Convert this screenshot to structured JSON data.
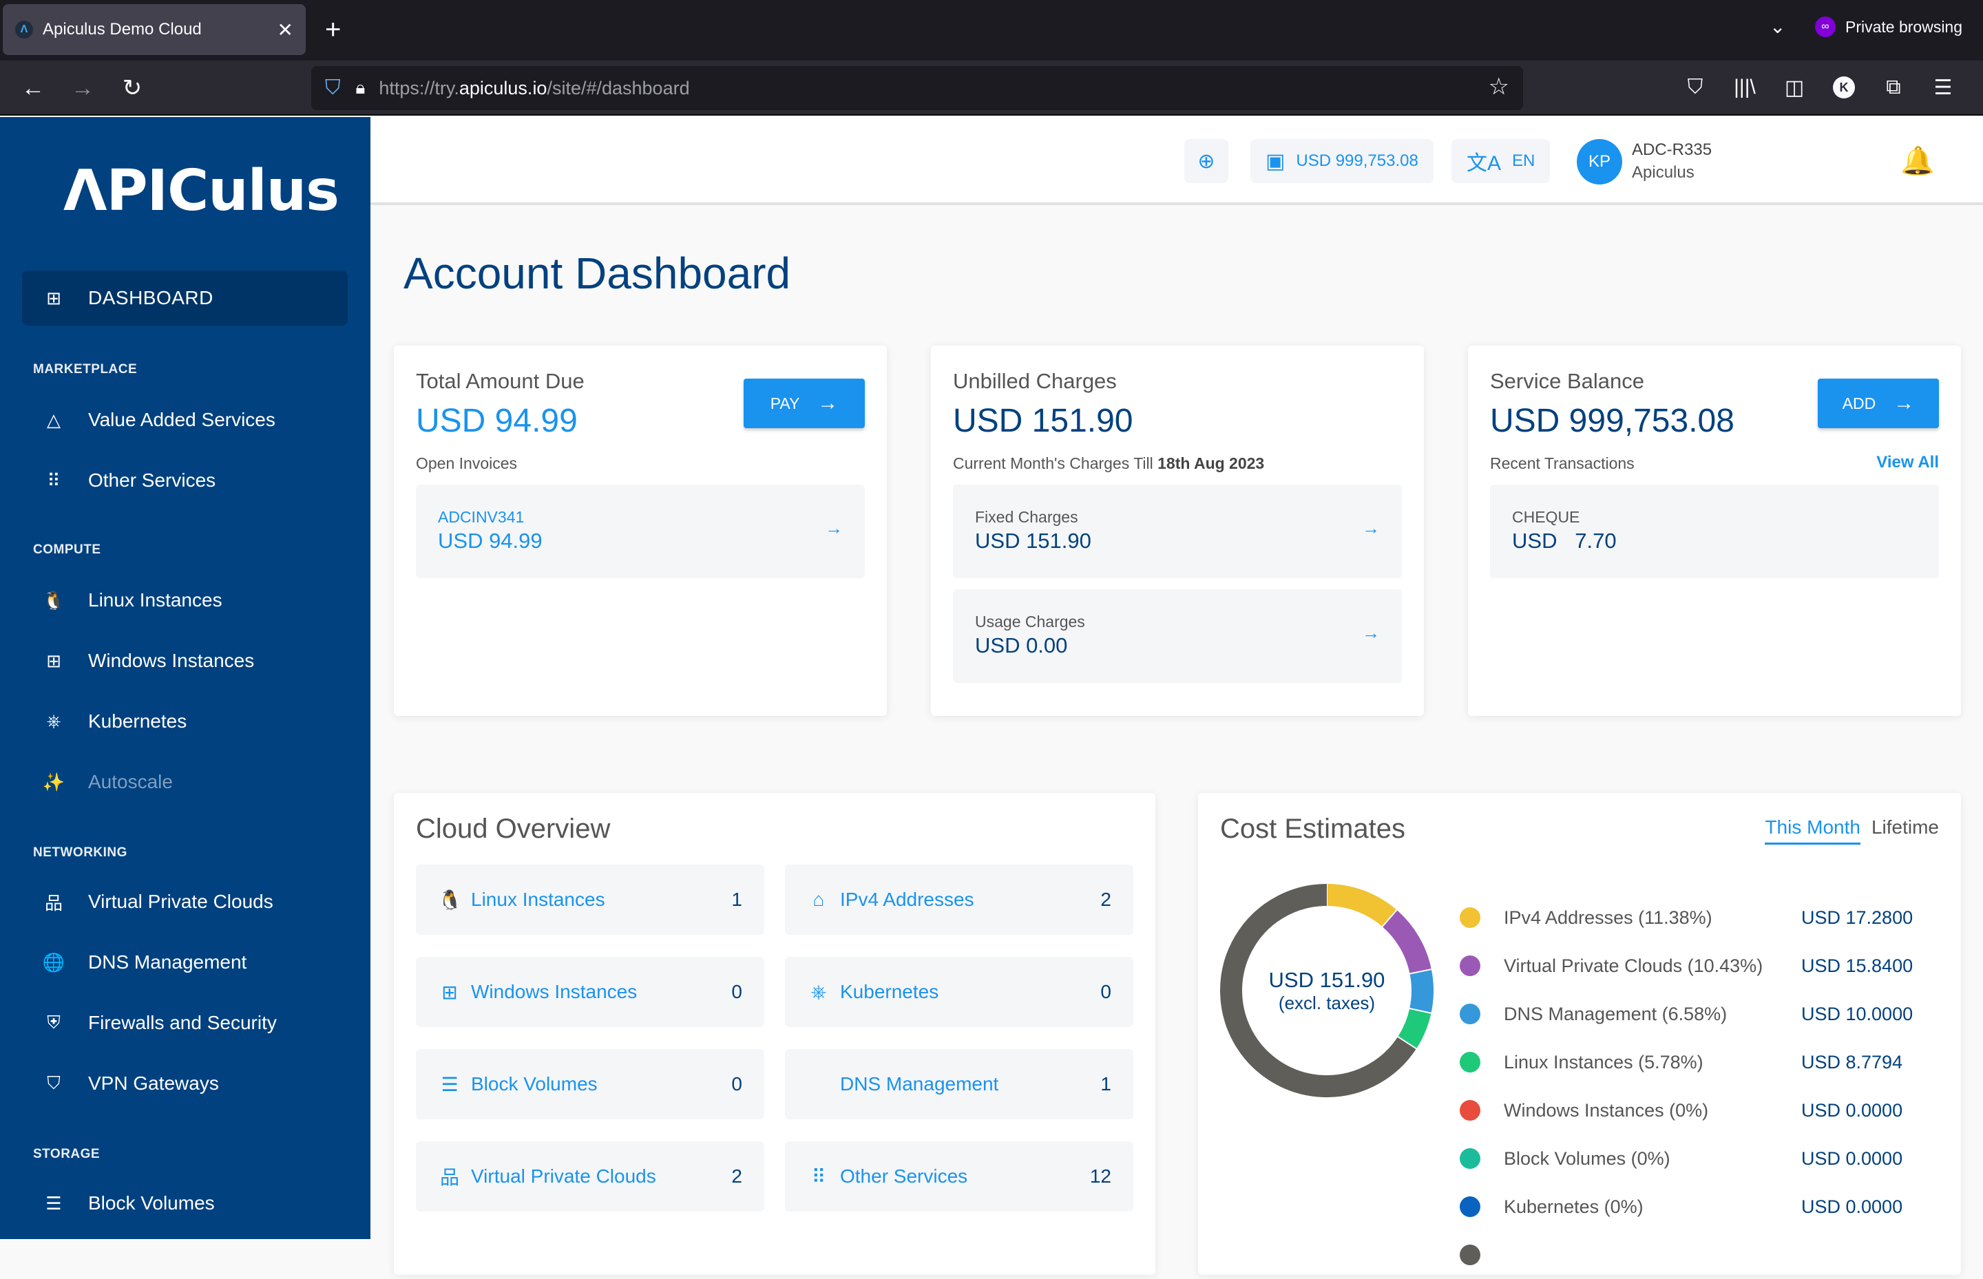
{
  "browser": {
    "tab_title": "Apiculus Demo Cloud",
    "tab_favicon": "Λ",
    "close_icon": "✕",
    "new_tab_icon": "+",
    "tabs_menu_icon": "⌄",
    "private_label": "Private browsing",
    "url_prefix": "https://try.",
    "url_domain": "apiculus.io",
    "url_path": "/site/#/dashboard",
    "back_icon": "←",
    "forward_icon": "→",
    "reload_icon": "↻",
    "shield_icon": "⛉",
    "lock_icon": "🔒",
    "star_icon": "☆",
    "toolbar_icons": {
      "pocket": "⛉",
      "library": "|||\\",
      "sidebar": "◫",
      "account": "K",
      "extensions": "⧉",
      "menu": "☰"
    }
  },
  "sidebar": {
    "logo": "ΛPICulus",
    "dashboard": {
      "label": "DASHBOARD",
      "icon": "⊞"
    },
    "sections": [
      {
        "title": "MARKETPLACE",
        "items": [
          {
            "label": "Value Added Services",
            "icon": "△"
          },
          {
            "label": "Other Services",
            "icon": "⠿"
          }
        ]
      },
      {
        "title": "COMPUTE",
        "items": [
          {
            "label": "Linux Instances",
            "icon": "🐧"
          },
          {
            "label": "Windows Instances",
            "icon": "⊞"
          },
          {
            "label": "Kubernetes",
            "icon": "⎈"
          },
          {
            "label": "Autoscale",
            "icon": "✨",
            "disabled": true
          }
        ]
      },
      {
        "title": "NETWORKING",
        "items": [
          {
            "label": "Virtual Private Clouds",
            "icon": "品"
          },
          {
            "label": "DNS Management",
            "icon": "🌐"
          },
          {
            "label": "Firewalls and Security",
            "icon": "⛨"
          },
          {
            "label": "VPN Gateways",
            "icon": "⛉"
          }
        ]
      },
      {
        "title": "STORAGE",
        "items": [
          {
            "label": "Block Volumes",
            "icon": "☰"
          }
        ]
      }
    ]
  },
  "header": {
    "support_icon": "⊕",
    "wallet_icon": "▣",
    "balance": "USD 999,753.08",
    "language_icon": "文A",
    "language": "EN",
    "avatar_initials": "KP",
    "user_name": "ADC-R335",
    "user_org": "Apiculus",
    "bell_icon": "🔔"
  },
  "page": {
    "title": "Account Dashboard"
  },
  "cards": {
    "total_due": {
      "title": "Total Amount Due",
      "amount": "USD 94.99",
      "button": "PAY",
      "arrow": "→",
      "subtitle": "Open Invoices",
      "invoices": [
        {
          "id": "ADCINV341",
          "amount": "USD 94.99"
        }
      ]
    },
    "unbilled": {
      "title": "Unbilled Charges",
      "amount": "USD 151.90",
      "subtitle_prefix": "Current Month's Charges Till ",
      "subtitle_date": "18th Aug 2023",
      "items": [
        {
          "label": "Fixed Charges",
          "amount": "USD 151.90"
        },
        {
          "label": "Usage Charges",
          "amount": "USD 0.00"
        }
      ]
    },
    "service_balance": {
      "title": "Service Balance",
      "amount": "USD 999,753.08",
      "button": "ADD",
      "subtitle": "Recent Transactions",
      "view_all": "View All",
      "transactions": [
        {
          "type": "CHEQUE",
          "amount": "USD   7.70"
        }
      ]
    }
  },
  "cloud_overview": {
    "title": "Cloud Overview",
    "tiles": [
      {
        "name": "Linux Instances",
        "count": "1",
        "icon": "🐧"
      },
      {
        "name": "IPv4 Addresses",
        "count": "2",
        "icon": "⌂"
      },
      {
        "name": "Windows Instances",
        "count": "0",
        "icon": "⊞"
      },
      {
        "name": "Kubernetes",
        "count": "0",
        "icon": "⎈"
      },
      {
        "name": "Block Volumes",
        "count": "0",
        "icon": "☰"
      },
      {
        "name": "DNS Management",
        "count": "1",
        "icon": ""
      },
      {
        "name": "Virtual Private Clouds",
        "count": "2",
        "icon": "品"
      },
      {
        "name": "Other Services",
        "count": "12",
        "icon": "⠿"
      }
    ]
  },
  "cost_estimates": {
    "title": "Cost Estimates",
    "tabs": [
      {
        "label": "This Month",
        "active": true
      },
      {
        "label": "Lifetime",
        "active": false
      }
    ],
    "center_value": "USD 151.90",
    "center_note": "(excl. taxes)"
  },
  "chart_data": {
    "type": "pie",
    "title": "Cost Estimates",
    "total": 151.9,
    "series": [
      {
        "name": "IPv4 Addresses",
        "percent": 11.38,
        "value": 17.28,
        "label": "IPv4 Addresses (11.38%)",
        "amount_label": "USD 17.2800",
        "color": "#f1c232"
      },
      {
        "name": "Virtual Private Clouds",
        "percent": 10.43,
        "value": 15.84,
        "label": "Virtual Private Clouds (10.43%)",
        "amount_label": "USD 15.8400",
        "color": "#9b59b6"
      },
      {
        "name": "DNS Management",
        "percent": 6.58,
        "value": 10.0,
        "label": "DNS Management (6.58%)",
        "amount_label": "USD 10.0000",
        "color": "#3498db"
      },
      {
        "name": "Linux Instances",
        "percent": 5.78,
        "value": 8.7794,
        "label": "Linux Instances (5.78%)",
        "amount_label": "USD 8.7794",
        "color": "#1ec97a"
      },
      {
        "name": "Windows Instances",
        "percent": 0,
        "value": 0,
        "label": "Windows Instances (0%)",
        "amount_label": "USD 0.0000",
        "color": "#e74c3c"
      },
      {
        "name": "Block Volumes",
        "percent": 0,
        "value": 0,
        "label": "Block Volumes (0%)",
        "amount_label": "USD 0.0000",
        "color": "#1abc9c"
      },
      {
        "name": "Kubernetes",
        "percent": 0,
        "value": 0,
        "label": "Kubernetes (0%)",
        "amount_label": "USD 0.0000",
        "color": "#0b63c1"
      },
      {
        "name": "",
        "percent": 65.83,
        "value": 100.0,
        "label": "",
        "amount_label": "",
        "color": "#5f5e59"
      }
    ]
  }
}
